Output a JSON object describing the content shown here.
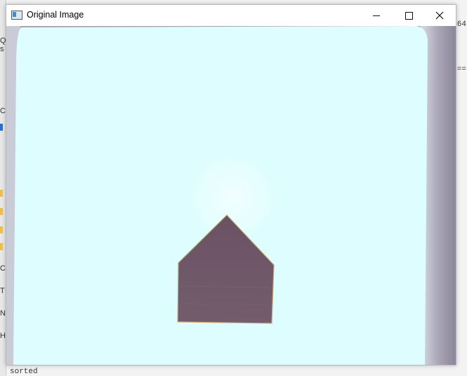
{
  "window": {
    "title": "Original Image",
    "minimize_label": "",
    "maximize_label": "",
    "close_label": ""
  },
  "background": {
    "right_text_1": "64",
    "right_text_2": "==",
    "left_glyphs": [
      "Q",
      "s",
      "C",
      "C",
      "T",
      "N",
      "H"
    ],
    "bottom_text_1": "sorted"
  },
  "image": {
    "description_colors": {
      "screen": "#ddfdfe",
      "vignette": "#a9a5b3",
      "shape": "#6e5868",
      "shape_edge": "#c8a86a"
    }
  }
}
